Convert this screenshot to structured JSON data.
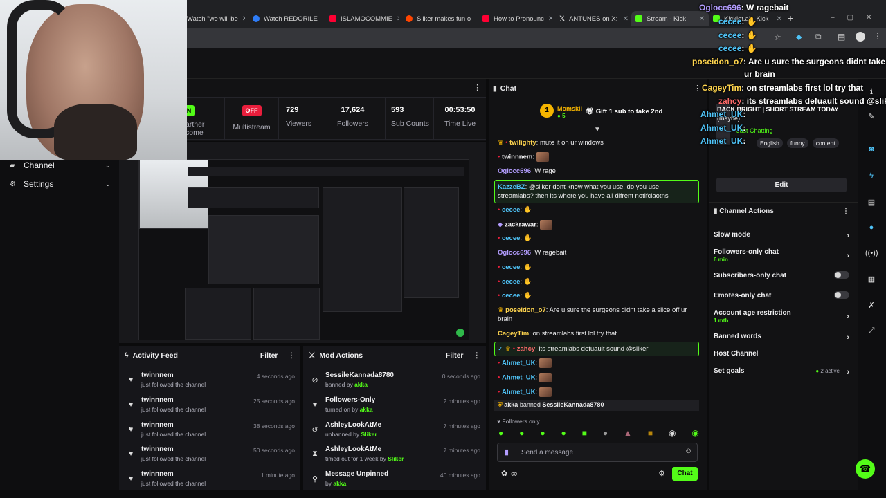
{
  "browser": {
    "tabs": [
      {
        "title": "Watch \"we will be",
        "color": "#1a1a1a"
      },
      {
        "title": "Watch REDORILE",
        "color": "#2e7cf6"
      },
      {
        "title": "ISLAMOCOMMIE",
        "color": "#ff0033"
      },
      {
        "title": "Sliker makes fun o",
        "color": "#ff4500"
      },
      {
        "title": "How to Pronounc",
        "color": "#ff0033"
      },
      {
        "title": "ANTUNES on X:",
        "color": "#e0e0e0"
      },
      {
        "title": "Stream - Kick",
        "color": "#53fc18"
      },
      {
        "title": "Kicklet.ai - Kick",
        "color": "#53fc18"
      }
    ]
  },
  "sidebar": {
    "items": [
      {
        "label": "Channel",
        "icon": "broadcast-icon"
      },
      {
        "label": "Settings",
        "icon": "gear-icon"
      }
    ]
  },
  "stats": {
    "partner_text_1": "artner",
    "partner_text_2": "come",
    "on_label": "ON",
    "off_label": "OFF",
    "multistream_label": "Multistream",
    "items": [
      {
        "value": "729",
        "label": "Viewers"
      },
      {
        "value": "17,624",
        "label": "Followers"
      },
      {
        "value": "593",
        "label": "Sub Counts"
      },
      {
        "value": "00:53:50",
        "label": "Time Live"
      }
    ]
  },
  "activity": {
    "title": "Activity Feed",
    "filter": "Filter",
    "items": [
      {
        "name": "twinnnem",
        "desc": "just followed the channel",
        "time": "4 seconds ago"
      },
      {
        "name": "twinnnem",
        "desc": "just followed the channel",
        "time": "25 seconds ago"
      },
      {
        "name": "twinnnem",
        "desc": "just followed the channel",
        "time": "38 seconds ago"
      },
      {
        "name": "twinnnem",
        "desc": "just followed the channel",
        "time": "50 seconds ago"
      },
      {
        "name": "twinnnem",
        "desc": "just followed the channel",
        "time": "1 minute ago"
      }
    ]
  },
  "mod": {
    "title": "Mod Actions",
    "filter": "Filter",
    "items": [
      {
        "name": "SessileKannada8780",
        "prefix": "banned by",
        "by": "akka",
        "time": "0 seconds ago",
        "icon": "ban-icon"
      },
      {
        "name": "Followers-Only",
        "prefix": "turned on by",
        "by": "akka",
        "time": "2 minutes ago",
        "icon": "heart-icon"
      },
      {
        "name": "AshleyLookAtMe",
        "prefix": "unbanned by",
        "by": "Sliker",
        "time": "7 minutes ago",
        "icon": "undo-icon"
      },
      {
        "name": "AshleyLookAtMe",
        "prefix": "timed out for 1 week by",
        "by": "Sliker",
        "time": "7 minutes ago",
        "icon": "hourglass-icon"
      },
      {
        "name": "Message Unpinned",
        "prefix": "by",
        "by": "akka",
        "time": "40 minutes ago",
        "icon": "pin-icon"
      }
    ]
  },
  "chat": {
    "title": "Chat",
    "pinned_user": "Momskii",
    "pinned_count": "5",
    "pinned_gift": "Gift 1 sub to take 2nd",
    "messages": [
      {
        "user": "twilighty",
        "color": "#ffd54f",
        "text": "mute it on ur windows"
      },
      {
        "user": "twinnnem",
        "color": "#efeff1",
        "text": ""
      },
      {
        "user": "Oglocc696",
        "color": "#b39dff",
        "text": "W rage"
      },
      {
        "user": "KazzeBZ",
        "color": "#4fc3f7",
        "text": "@sliker dont know what you use, do you use streamlabs? then its where you have all difrent notifciaotns"
      },
      {
        "user": "cecee",
        "color": "#4fc3f7",
        "text": ""
      },
      {
        "user": "zackrawar",
        "color": "#efeff1",
        "text": ""
      },
      {
        "user": "cecee",
        "color": "#4fc3f7",
        "text": ""
      },
      {
        "user": "Oglocc696",
        "color": "#b39dff",
        "text": "W ragebait"
      },
      {
        "user": "cecee",
        "color": "#4fc3f7",
        "text": ""
      },
      {
        "user": "cecee",
        "color": "#4fc3f7",
        "text": ""
      },
      {
        "user": "cecee",
        "color": "#4fc3f7",
        "text": ""
      },
      {
        "user": "poseidon_o7",
        "color": "#ffd54f",
        "text": "Are u sure the surgeons didnt take a slice off ur brain"
      },
      {
        "user": "CageyTim",
        "color": "#ffd54f",
        "text": "on streamlabs first lol try that"
      },
      {
        "user": "zahcy",
        "color": "#ff6b6b",
        "text": "its streamlabs defuault sound @sliker"
      },
      {
        "user": "Ahmet_UK",
        "color": "#4fc3f7",
        "text": ""
      },
      {
        "user": "Ahmet_UK",
        "color": "#4fc3f7",
        "text": ""
      },
      {
        "user": "Ahmet_UK",
        "color": "#4fc3f7",
        "text": ""
      }
    ],
    "ban_notice_user": "akka",
    "ban_notice_mid": "banned",
    "ban_notice_target": "SessileKannada8780",
    "followers_only": "Followers only",
    "input_placeholder": "Send a message",
    "send_label": "Chat"
  },
  "stream_info": {
    "title": "BACK BRIGHT | SHORT STREAM TODAY",
    "subtitle": "(maybe)",
    "category": "Just Chatting",
    "tags": [
      "English",
      "funny",
      "content"
    ],
    "edit_label": "Edit"
  },
  "channel_actions": {
    "title": "Channel Actions",
    "items": [
      {
        "label": "Slow mode",
        "sub": "",
        "control": "arrow"
      },
      {
        "label": "Followers-only chat",
        "sub": "6 min",
        "control": "arrow"
      },
      {
        "label": "Subscribers-only chat",
        "sub": "",
        "control": "toggle"
      },
      {
        "label": "Emotes-only chat",
        "sub": "",
        "control": "toggle"
      },
      {
        "label": "Account age restriction",
        "sub": "1 mth",
        "control": "arrow"
      },
      {
        "label": "Banned words",
        "sub": "",
        "control": "arrow"
      },
      {
        "label": "Host Channel",
        "sub": "",
        "control": "none"
      },
      {
        "label": "Set goals",
        "sub": "",
        "control": "arrow",
        "badge": "2 active"
      }
    ]
  },
  "overlay_chat": [
    {
      "user": "Oglocc696",
      "text": "W ragebait"
    },
    {
      "user": "cecee",
      "text": ""
    },
    {
      "user": "cecee",
      "text": ""
    },
    {
      "user": "cecee",
      "text": ""
    },
    {
      "user": "poseidon_o7",
      "text": "Are u sure the surgeons didnt take a"
    },
    {
      "user": "",
      "text": "ur brain"
    },
    {
      "user": "CageyTim",
      "text": "on streamlabs first lol try that"
    },
    {
      "user": "zahcy",
      "text": "its streamlabs defuault sound @sliker"
    },
    {
      "user": "Ahmet_UK",
      "text": ""
    },
    {
      "user": "Ahmet_UK",
      "text": ""
    },
    {
      "user": "Ahmet_UK",
      "text": ""
    }
  ],
  "colors": {
    "accent": "#53fc18",
    "bg": "#0b0b0c",
    "panel": "#16161a"
  }
}
